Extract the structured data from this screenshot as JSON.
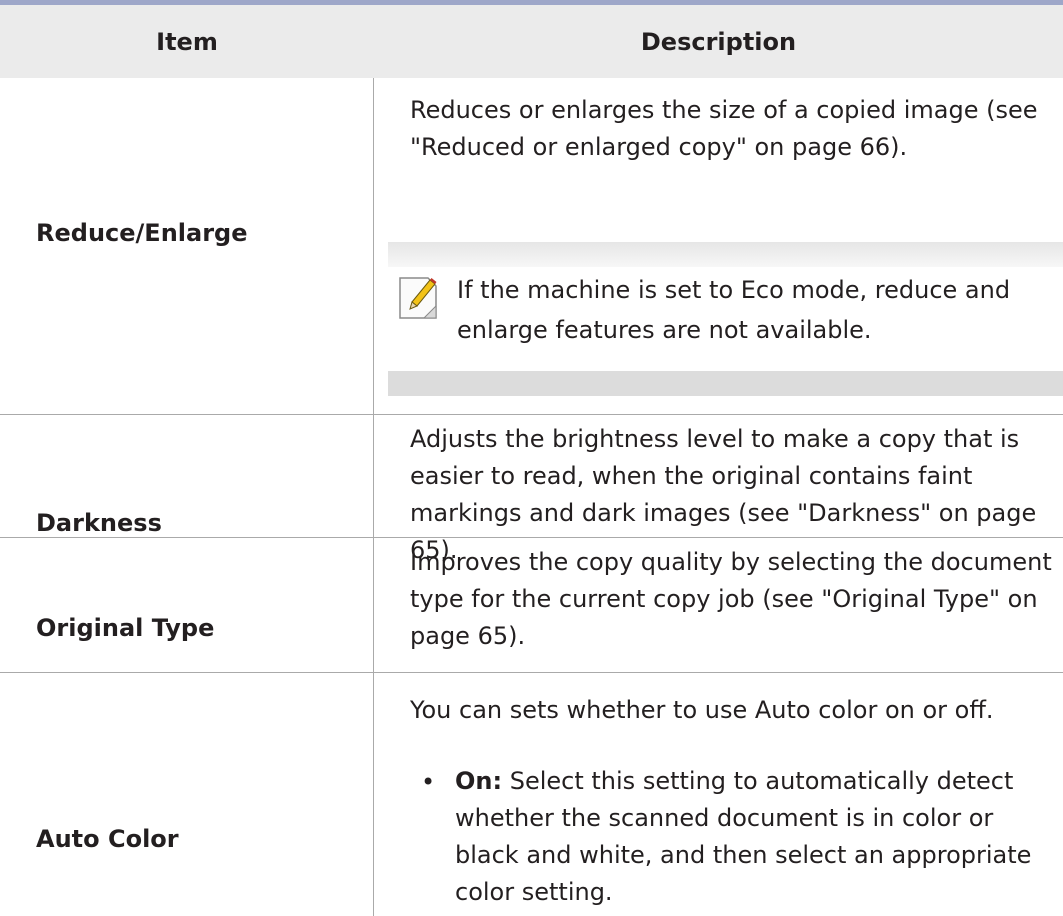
{
  "table": {
    "header": {
      "item": "Item",
      "description": "Description"
    },
    "rows": [
      {
        "item": "Reduce/Enlarge",
        "description": "Reduces or enlarges the size of a copied image (see \"Reduced or enlarged copy\" on page 66).",
        "note": "If the machine is set to Eco mode, reduce and enlarge features are not available."
      },
      {
        "item": "Darkness",
        "description": "Adjusts the brightness level to make a copy that is easier to read, when the original contains faint markings and dark images (see \"Darkness\" on page 65)."
      },
      {
        "item": "Original Type",
        "description": "Improves the copy quality by selecting the document type for the current copy job (see \"Original Type\" on page 65)."
      },
      {
        "item": "Auto Color",
        "description": "You can sets whether to use Auto color on or off.",
        "bullet_symbol": "•",
        "bullet_term": "On:",
        "bullet_text": " Select this setting to automatically detect whether the scanned document is in color or black and white, and then select an appropriate color setting."
      }
    ]
  },
  "icons": {
    "note": "note-pencil-icon"
  },
  "colors": {
    "top_rule": "#9ea7c9",
    "header_bg": "#ebebeb",
    "grid_line": "#aaaaaa"
  }
}
